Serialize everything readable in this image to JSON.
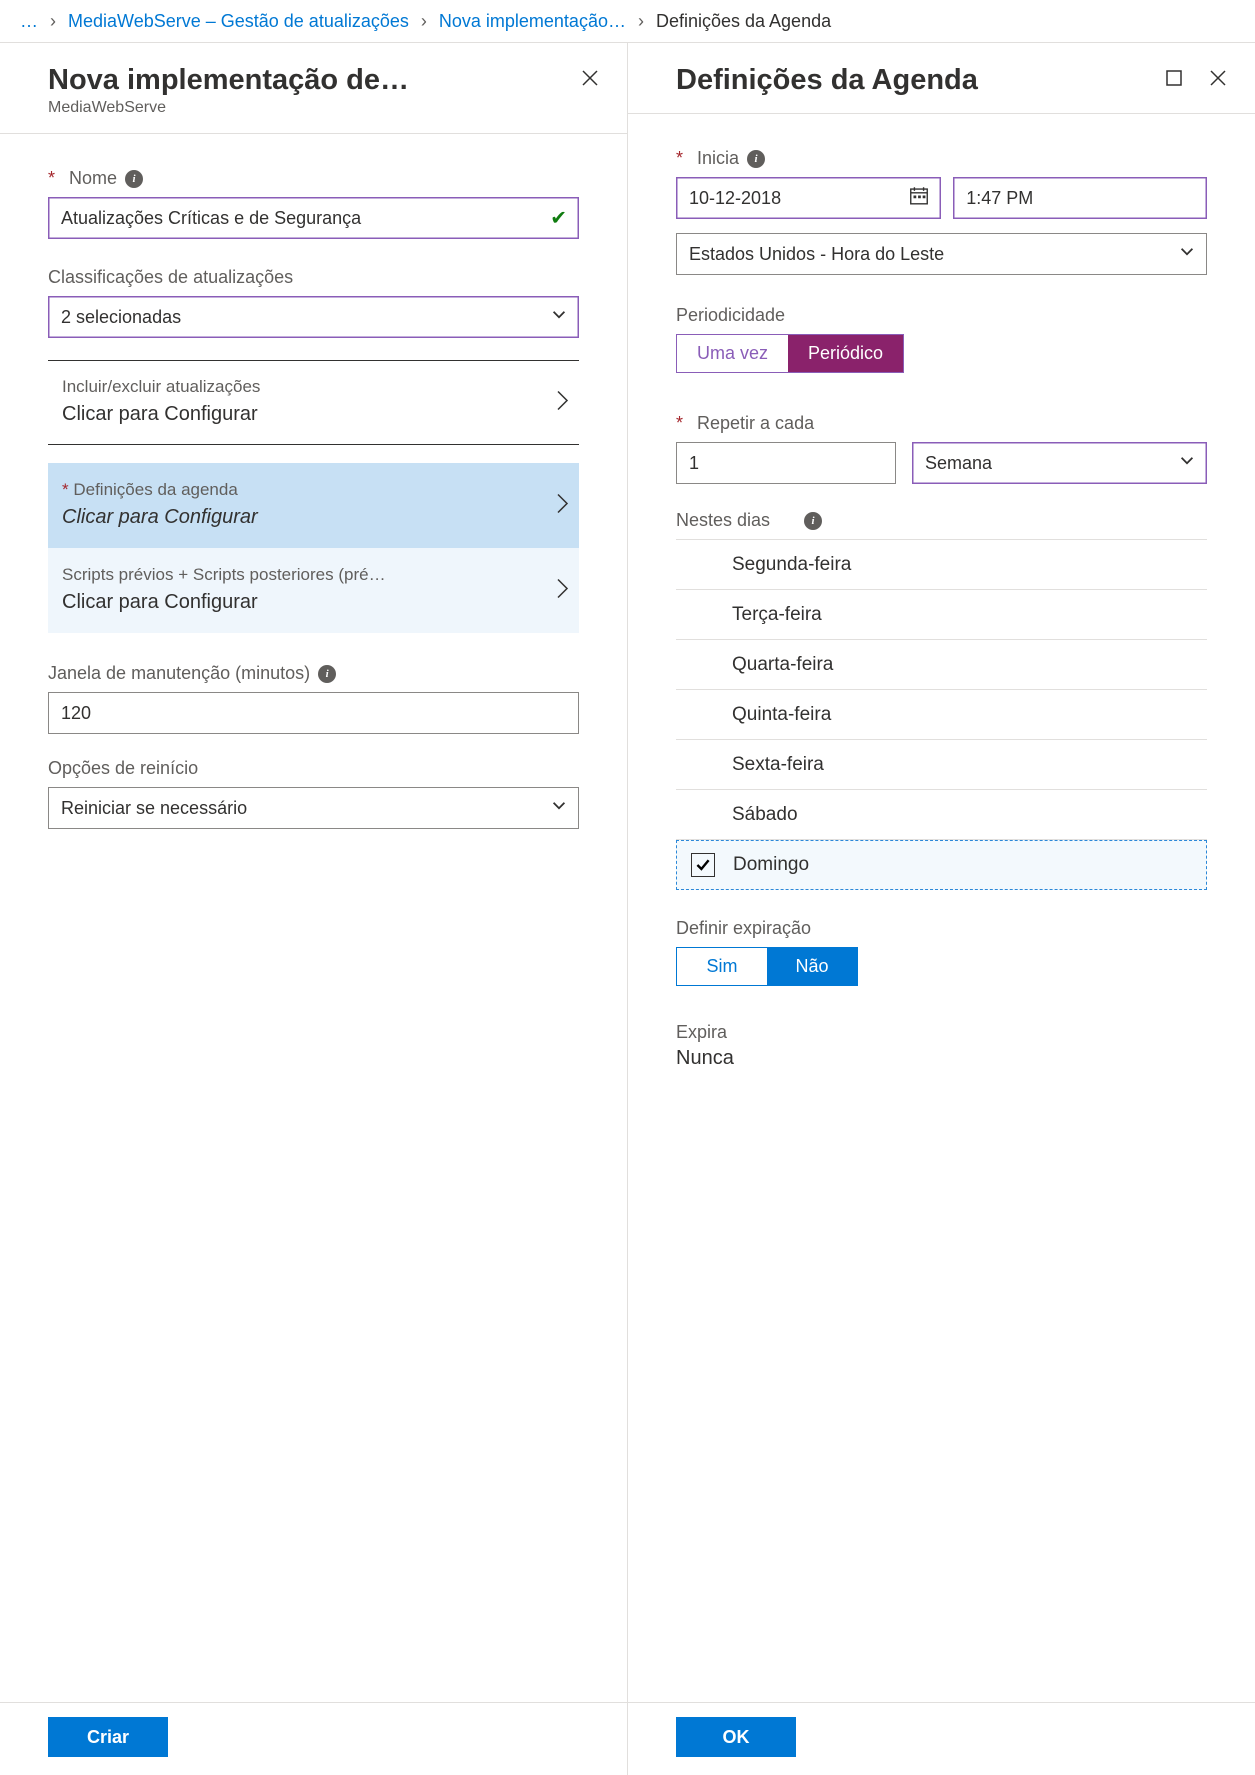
{
  "breadcrumb": {
    "ellipsis": "…",
    "items": [
      {
        "text": "MediaWebServe – Gestão de atualizações",
        "link": true
      },
      {
        "text": "Nova implementação…",
        "link": true
      },
      {
        "text": "Definições da Agenda",
        "link": false
      }
    ]
  },
  "left": {
    "title": "Nova implementação de…",
    "subtitle": "MediaWebServe",
    "name_label": "Nome",
    "name_value": "Atualizações Críticas e de Segurança",
    "class_label": "Classificações de atualizações",
    "class_value": "2 selecionadas",
    "include_exclude_label": "Incluir/excluir atualizações",
    "schedule_label": "Definições da agenda",
    "scripts_label": "Scripts prévios + Scripts posteriores (pré…",
    "configure_text": "Clicar para Configurar",
    "maint_label": "Janela de manutenção (minutos)",
    "maint_value": "120",
    "restart_label": "Opções de reinício",
    "restart_value": "Reiniciar se necessário",
    "create_btn": "Criar"
  },
  "right": {
    "title": "Definições da Agenda",
    "start_label": "Inicia",
    "start_date": "10-12-2018",
    "start_time": "1:47 PM",
    "tz_value": "Estados Unidos - Hora do Leste",
    "period_label": "Periodicidade",
    "period_once": "Uma vez",
    "period_recurring": "Periódico",
    "recur_label": "Repetir a cada",
    "recur_value": "1",
    "recur_unit": "Semana",
    "days_label": "Nestes dias",
    "days": [
      {
        "name": "Segunda-feira",
        "checked": false
      },
      {
        "name": "Terça-feira",
        "checked": false
      },
      {
        "name": "Quarta-feira",
        "checked": false
      },
      {
        "name": "Quinta-feira",
        "checked": false
      },
      {
        "name": "Sexta-feira",
        "checked": false
      },
      {
        "name": "Sábado",
        "checked": false
      },
      {
        "name": "Domingo",
        "checked": true
      }
    ],
    "expire_label": "Definir expiração",
    "expire_yes": "Sim",
    "expire_no": "Não",
    "expires_field_label": "Expira",
    "expires_value": "Nunca",
    "ok_btn": "OK"
  }
}
